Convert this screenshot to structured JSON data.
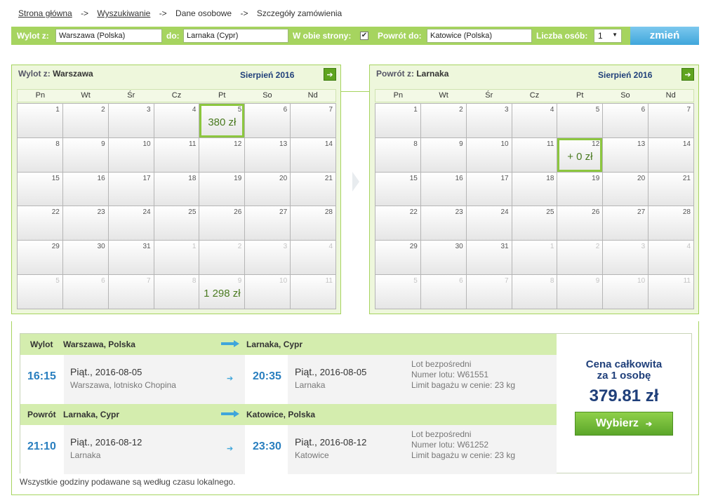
{
  "breadcrumb": {
    "home": "Strona główna",
    "search": "Wyszukiwanie",
    "personal": "Dane osobowe",
    "details": "Szczegóły zamówienia",
    "separator": "->"
  },
  "search": {
    "from_label": "Wylot z:",
    "from_value": "Warszawa (Polska)",
    "to_label": "do:",
    "to_value": "Larnaka (Cypr)",
    "roundtrip_label": "W obie strony:",
    "roundtrip_checked": "✔",
    "return_label": "Powrót do:",
    "return_value": "Katowice (Polska)",
    "people_label": "Liczba osób:",
    "people_value": "1",
    "change_label": "zmień"
  },
  "weekdays": [
    "Pn",
    "Wt",
    "Śr",
    "Cz",
    "Pt",
    "So",
    "Nd"
  ],
  "outbound_calendar": {
    "title_prefix": "Wylot z:",
    "title_city": "Warszawa",
    "month": "Sierpień 2016",
    "days": [
      {
        "day": "1",
        "other": false,
        "price": "",
        "selected": false
      },
      {
        "day": "2",
        "other": false,
        "price": "",
        "selected": false
      },
      {
        "day": "3",
        "other": false,
        "price": "",
        "selected": false
      },
      {
        "day": "4",
        "other": false,
        "price": "",
        "selected": false
      },
      {
        "day": "5",
        "other": false,
        "price": "380 zł",
        "selected": true
      },
      {
        "day": "6",
        "other": false,
        "price": "",
        "selected": false
      },
      {
        "day": "7",
        "other": false,
        "price": "",
        "selected": false
      },
      {
        "day": "8",
        "other": false,
        "price": "",
        "selected": false
      },
      {
        "day": "9",
        "other": false,
        "price": "",
        "selected": false
      },
      {
        "day": "10",
        "other": false,
        "price": "",
        "selected": false
      },
      {
        "day": "11",
        "other": false,
        "price": "",
        "selected": false
      },
      {
        "day": "12",
        "other": false,
        "price": "",
        "selected": false
      },
      {
        "day": "13",
        "other": false,
        "price": "",
        "selected": false
      },
      {
        "day": "14",
        "other": false,
        "price": "",
        "selected": false
      },
      {
        "day": "15",
        "other": false,
        "price": "",
        "selected": false
      },
      {
        "day": "16",
        "other": false,
        "price": "",
        "selected": false
      },
      {
        "day": "17",
        "other": false,
        "price": "",
        "selected": false
      },
      {
        "day": "18",
        "other": false,
        "price": "",
        "selected": false
      },
      {
        "day": "19",
        "other": false,
        "price": "",
        "selected": false
      },
      {
        "day": "20",
        "other": false,
        "price": "",
        "selected": false
      },
      {
        "day": "21",
        "other": false,
        "price": "",
        "selected": false
      },
      {
        "day": "22",
        "other": false,
        "price": "",
        "selected": false
      },
      {
        "day": "23",
        "other": false,
        "price": "",
        "selected": false
      },
      {
        "day": "24",
        "other": false,
        "price": "",
        "selected": false
      },
      {
        "day": "25",
        "other": false,
        "price": "",
        "selected": false
      },
      {
        "day": "26",
        "other": false,
        "price": "",
        "selected": false
      },
      {
        "day": "27",
        "other": false,
        "price": "",
        "selected": false
      },
      {
        "day": "28",
        "other": false,
        "price": "",
        "selected": false
      },
      {
        "day": "29",
        "other": false,
        "price": "",
        "selected": false
      },
      {
        "day": "30",
        "other": false,
        "price": "",
        "selected": false
      },
      {
        "day": "31",
        "other": false,
        "price": "",
        "selected": false
      },
      {
        "day": "1",
        "other": true,
        "price": "",
        "selected": false
      },
      {
        "day": "2",
        "other": true,
        "price": "",
        "selected": false
      },
      {
        "day": "3",
        "other": true,
        "price": "",
        "selected": false
      },
      {
        "day": "4",
        "other": true,
        "price": "",
        "selected": false
      },
      {
        "day": "5",
        "other": true,
        "price": "",
        "selected": false
      },
      {
        "day": "6",
        "other": true,
        "price": "",
        "selected": false
      },
      {
        "day": "7",
        "other": true,
        "price": "",
        "selected": false
      },
      {
        "day": "8",
        "other": true,
        "price": "",
        "selected": false
      },
      {
        "day": "9",
        "other": true,
        "price": "1 298 zł",
        "selected": false
      },
      {
        "day": "10",
        "other": true,
        "price": "",
        "selected": false
      },
      {
        "day": "11",
        "other": true,
        "price": "",
        "selected": false
      }
    ]
  },
  "return_calendar": {
    "title_prefix": "Powrót z:",
    "title_city": "Larnaka",
    "month": "Sierpień 2016",
    "days": [
      {
        "day": "1",
        "other": false,
        "price": "",
        "selected": false
      },
      {
        "day": "2",
        "other": false,
        "price": "",
        "selected": false
      },
      {
        "day": "3",
        "other": false,
        "price": "",
        "selected": false
      },
      {
        "day": "4",
        "other": false,
        "price": "",
        "selected": false
      },
      {
        "day": "5",
        "other": false,
        "price": "",
        "selected": false
      },
      {
        "day": "6",
        "other": false,
        "price": "",
        "selected": false
      },
      {
        "day": "7",
        "other": false,
        "price": "",
        "selected": false
      },
      {
        "day": "8",
        "other": false,
        "price": "",
        "selected": false
      },
      {
        "day": "9",
        "other": false,
        "price": "",
        "selected": false
      },
      {
        "day": "10",
        "other": false,
        "price": "",
        "selected": false
      },
      {
        "day": "11",
        "other": false,
        "price": "",
        "selected": false
      },
      {
        "day": "12",
        "other": false,
        "price": "+ 0 zł",
        "selected": true
      },
      {
        "day": "13",
        "other": false,
        "price": "",
        "selected": false
      },
      {
        "day": "14",
        "other": false,
        "price": "",
        "selected": false
      },
      {
        "day": "15",
        "other": false,
        "price": "",
        "selected": false
      },
      {
        "day": "16",
        "other": false,
        "price": "",
        "selected": false
      },
      {
        "day": "17",
        "other": false,
        "price": "",
        "selected": false
      },
      {
        "day": "18",
        "other": false,
        "price": "",
        "selected": false
      },
      {
        "day": "19",
        "other": false,
        "price": "",
        "selected": false
      },
      {
        "day": "20",
        "other": false,
        "price": "",
        "selected": false
      },
      {
        "day": "21",
        "other": false,
        "price": "",
        "selected": false
      },
      {
        "day": "22",
        "other": false,
        "price": "",
        "selected": false
      },
      {
        "day": "23",
        "other": false,
        "price": "",
        "selected": false
      },
      {
        "day": "24",
        "other": false,
        "price": "",
        "selected": false
      },
      {
        "day": "25",
        "other": false,
        "price": "",
        "selected": false
      },
      {
        "day": "26",
        "other": false,
        "price": "",
        "selected": false
      },
      {
        "day": "27",
        "other": false,
        "price": "",
        "selected": false
      },
      {
        "day": "28",
        "other": false,
        "price": "",
        "selected": false
      },
      {
        "day": "29",
        "other": false,
        "price": "",
        "selected": false
      },
      {
        "day": "30",
        "other": false,
        "price": "",
        "selected": false
      },
      {
        "day": "31",
        "other": false,
        "price": "",
        "selected": false
      },
      {
        "day": "1",
        "other": true,
        "price": "",
        "selected": false
      },
      {
        "day": "2",
        "other": true,
        "price": "",
        "selected": false
      },
      {
        "day": "3",
        "other": true,
        "price": "",
        "selected": false
      },
      {
        "day": "4",
        "other": true,
        "price": "",
        "selected": false
      },
      {
        "day": "5",
        "other": true,
        "price": "",
        "selected": false
      },
      {
        "day": "6",
        "other": true,
        "price": "",
        "selected": false
      },
      {
        "day": "7",
        "other": true,
        "price": "",
        "selected": false
      },
      {
        "day": "8",
        "other": true,
        "price": "",
        "selected": false
      },
      {
        "day": "9",
        "other": true,
        "price": "",
        "selected": false
      },
      {
        "day": "10",
        "other": true,
        "price": "",
        "selected": false
      },
      {
        "day": "11",
        "other": true,
        "price": "",
        "selected": false
      }
    ]
  },
  "outbound": {
    "label": "Wylot",
    "from": "Warszawa, Polska",
    "to": "Larnaka, Cypr",
    "dep_time": "16:15",
    "dep_day": "Piąt.",
    "dep_date": "2016-08-05",
    "dep_place": "Warszawa, lotnisko Chopina",
    "arr_time": "20:35",
    "arr_day": "Piąt.",
    "arr_date": "2016-08-05",
    "arr_place": "Larnaka",
    "info_type": "Lot bezpośredni",
    "info_flight": "Numer lotu: W61551",
    "info_baggage": "Limit bagażu w cenie: 23 kg"
  },
  "inbound": {
    "label": "Powrót",
    "from": "Larnaka, Cypr",
    "to": "Katowice, Polska",
    "dep_time": "21:10",
    "dep_day": "Piąt.",
    "dep_date": "2016-08-12",
    "dep_place": "Larnaka",
    "arr_time": "23:30",
    "arr_day": "Piąt.",
    "arr_date": "2016-08-12",
    "arr_place": "Katowice",
    "info_type": "Lot bezpośredni",
    "info_flight": "Numer lotu: W61252",
    "info_baggage": "Limit bagażu w cenie: 23 kg"
  },
  "price": {
    "label_line1": "Cena całkowita",
    "label_line2": "za 1 osobę",
    "value": "379.81 zł",
    "choose_label": "Wybierz"
  },
  "footnote": "Wszystkie godziny podawane są według czasu lokalnego.",
  "icons": {
    "next_month": "chevron-right-icon",
    "flight_arrow": "arrow-right-icon"
  },
  "colors": {
    "accent_green": "#a6d45f",
    "header_green": "#d4edae",
    "time_blue": "#2a7fbf",
    "price_navy": "#1f3f7a",
    "change_blue": "#3fa6db"
  }
}
